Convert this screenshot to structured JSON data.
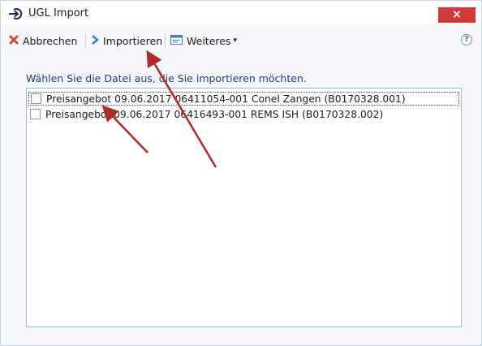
{
  "window": {
    "title": "UGL Import",
    "close_label": "×"
  },
  "toolbar": {
    "cancel_label": "Abbrechen",
    "import_label": "Importieren",
    "more_label": "Weiteres",
    "more_caret": "▾",
    "help_label": "?"
  },
  "instruction": "Wählen Sie die Datei aus, die Sie importieren möchten.",
  "files": [
    {
      "label": "Preisangebot 09.06.2017 06411054-001 Conel Zangen (B0170328.001)",
      "checked": false
    },
    {
      "label": "Preisangebot 09.06.2017 06416493-001 REMS ISH (B0170328.002)",
      "checked": false
    }
  ],
  "colors": {
    "accent": "#1f3a88",
    "close": "#d23b3b",
    "annotation_arrow": "#b02a2a"
  }
}
